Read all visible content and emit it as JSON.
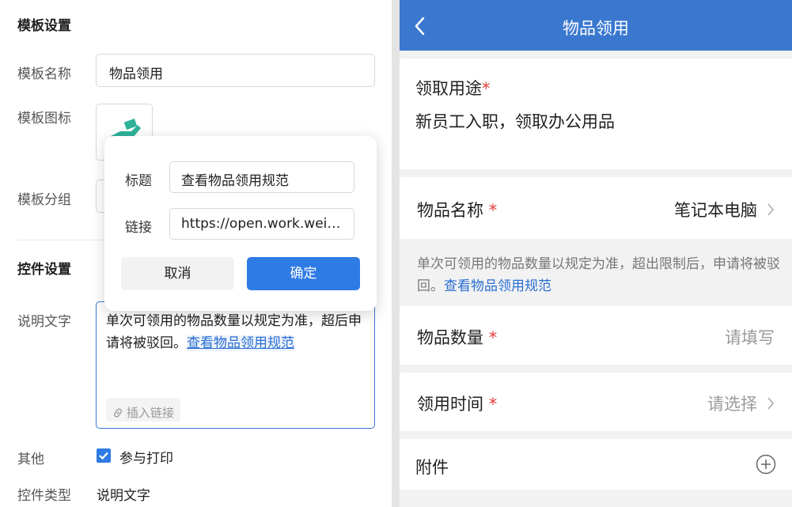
{
  "settings": {
    "template_section_title": "模板设置",
    "template_name_label": "模板名称",
    "template_name_value": "物品领用",
    "template_icon_label": "模板图标",
    "template_group_label": "模板分组",
    "control_section_title": "控件设置",
    "desc_label": "说明文字",
    "desc_text": "单次可领用的物品数量以规定为准，超后申请将被驳回。",
    "desc_link_text": "查看物品领用规范",
    "insert_link_label": "插入链接",
    "other_label": "其他",
    "print_checkbox_label": "参与打印",
    "print_checked": true,
    "control_type_label": "控件类型",
    "control_type_value": "说明文字"
  },
  "popup": {
    "title_label": "标题",
    "title_value": "查看物品领用规范",
    "link_label": "链接",
    "link_value": "https://open.work.weixi...",
    "cancel_label": "取消",
    "confirm_label": "确定"
  },
  "preview": {
    "header_title": "物品领用",
    "purpose_label": "领取用途",
    "purpose_value": "新员工入职，领取办公用品",
    "item_name_label": "物品名称",
    "item_name_value": "笔记本电脑",
    "note_text": "单次可领用的物品数量以规定为准，超出限制后，申请将被驳回。",
    "note_link": "查看物品领用规范",
    "quantity_label": "物品数量",
    "quantity_placeholder": "请填写",
    "time_label": "领用时间",
    "time_placeholder": "请选择",
    "attachment_label": "附件",
    "required_mark": "*"
  },
  "colors": {
    "accent": "#2f7be5",
    "header": "#3a78d0",
    "link": "#2a6fd3",
    "required": "#e23b3b"
  }
}
